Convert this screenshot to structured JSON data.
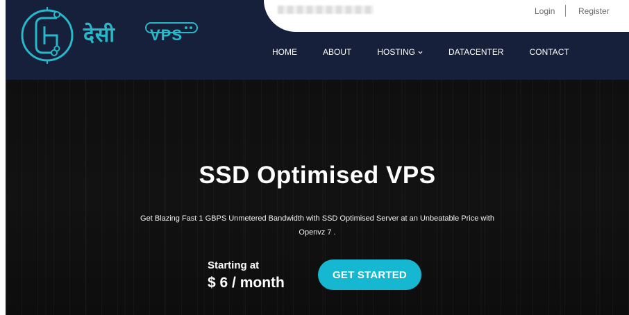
{
  "topbar": {
    "login": "Login",
    "register": "Register"
  },
  "logo": {
    "icon": "circuit-letter-icon",
    "devanagari": "देसी",
    "latin": "VPS",
    "color": "#28b8c9"
  },
  "nav": {
    "items": [
      {
        "label": "HOME"
      },
      {
        "label": "ABOUT"
      },
      {
        "label": "HOSTING",
        "icon": "chevron-down-icon"
      },
      {
        "label": "DATACENTER"
      },
      {
        "label": "CONTACT"
      }
    ]
  },
  "hero": {
    "title": "SSD Optimised VPS",
    "subtitle": "Get Blazing Fast 1 GBPS Unmetered Bandwidth with SSD Optimised Server at an Unbeatable Price with Openvz 7 .",
    "price_label": "Starting at",
    "price_value": "$ 6 / month",
    "cta_label": "GET STARTED"
  },
  "colors": {
    "header_bg": "#16203a",
    "accent": "#15b7d1",
    "hero_bg": "#0f0f0f"
  }
}
